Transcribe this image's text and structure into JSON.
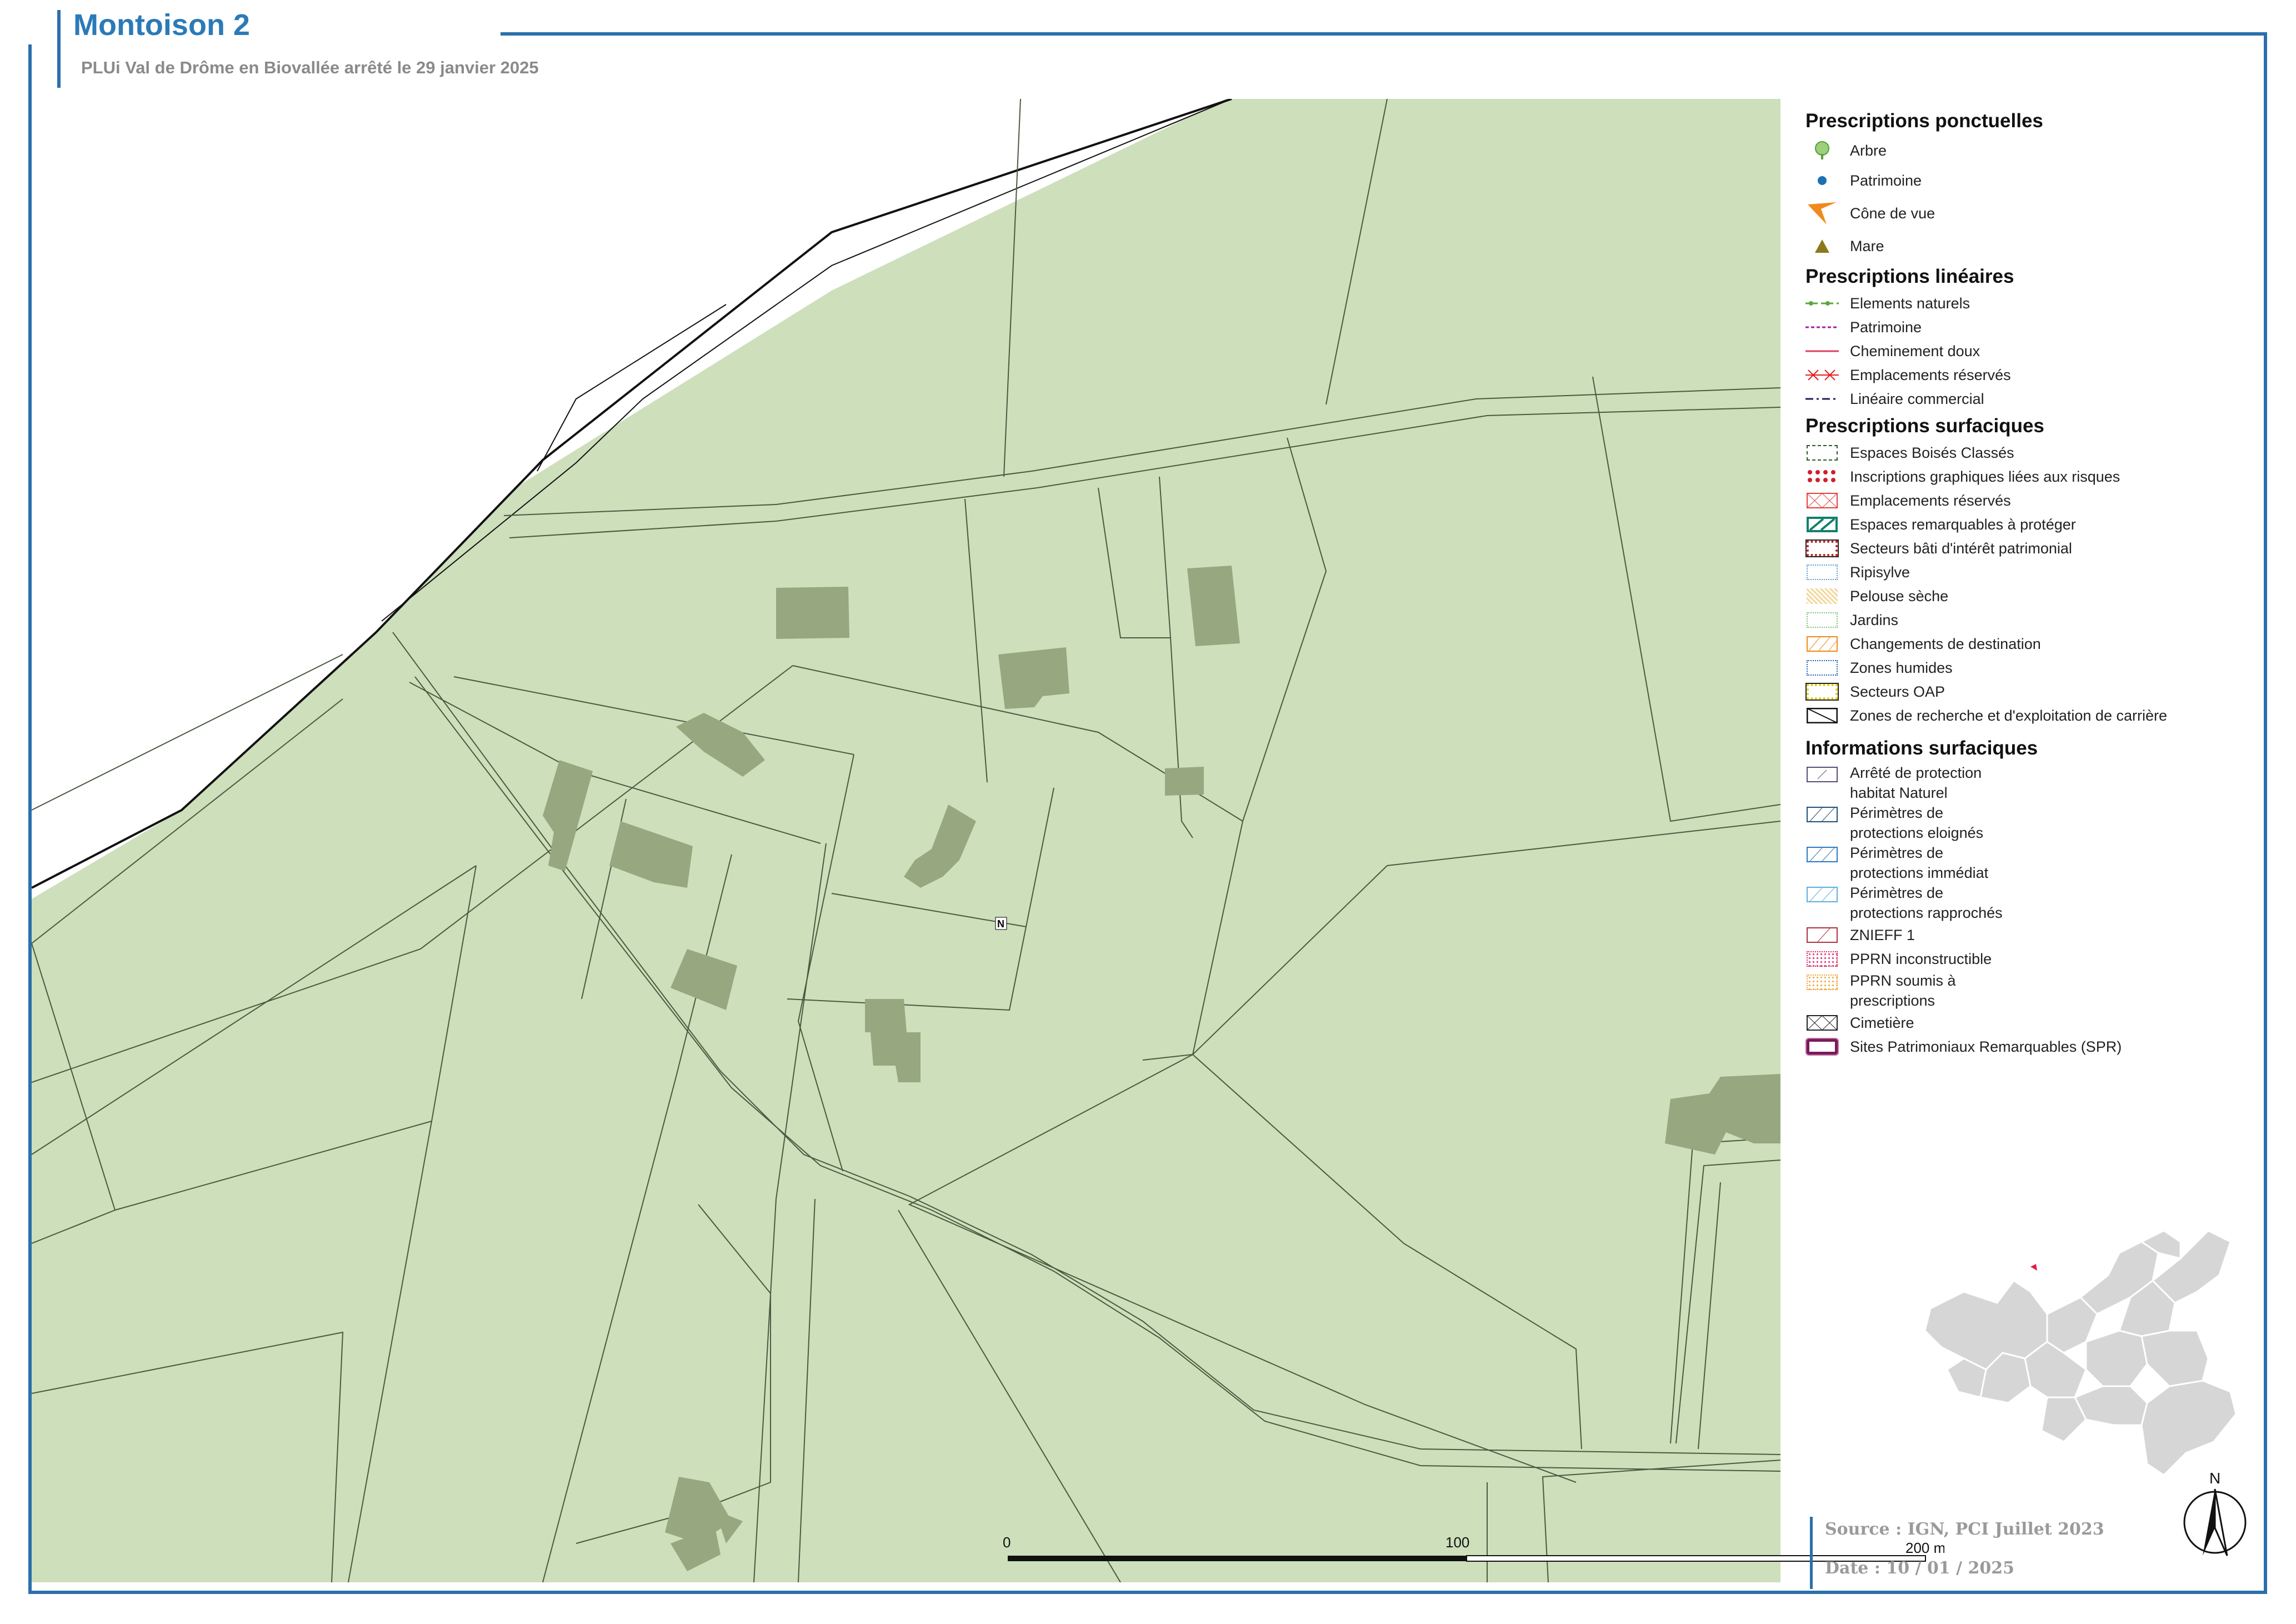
{
  "header": {
    "title": "Montoison 2",
    "subtitle": "PLUi Val de Drôme en Biovallée arrêté le 29 janvier 2025"
  },
  "map": {
    "land_color": "#cddfbb",
    "building_color": "#97a880",
    "parcel_line_color": "#3a4a32",
    "north_label": "N"
  },
  "legend": {
    "ponctuelles": {
      "heading": "Prescriptions ponctuelles",
      "items": [
        {
          "icon": "tree-icon",
          "label": "Arbre"
        },
        {
          "icon": "dot-icon",
          "label": "Patrimoine"
        },
        {
          "icon": "view-cone-icon",
          "label": "Cône de vue"
        },
        {
          "icon": "triangle-icon",
          "label": "Mare"
        }
      ]
    },
    "lineaires": {
      "heading": "Prescriptions linéaires",
      "items": [
        {
          "label": "Elements naturels"
        },
        {
          "label": "Patrimoine"
        },
        {
          "label": "Cheminement doux"
        },
        {
          "label": "Emplacements réservés"
        },
        {
          "label": "Linéaire commercial"
        }
      ]
    },
    "surfaciques": {
      "heading": "Prescriptions surfaciques",
      "items": [
        {
          "label": "Espaces Boisés Classés"
        },
        {
          "label": "Inscriptions graphiques liées aux risques"
        },
        {
          "label": "Emplacements réservés"
        },
        {
          "label": "Espaces remarquables à protéger"
        },
        {
          "label": "Secteurs bâti d'intérêt patrimonial"
        },
        {
          "label": "Ripisylve"
        },
        {
          "label": "Pelouse sèche"
        },
        {
          "label": "Jardins"
        },
        {
          "label": "Changements de destination"
        },
        {
          "label": "Zones humides"
        },
        {
          "label": "Secteurs OAP"
        },
        {
          "label": "Zones de recherche et d'exploitation de carrière"
        }
      ]
    },
    "informations": {
      "heading": "Informations surfaciques",
      "items": [
        {
          "line1": "Arrêté de protection",
          "line2": "habitat Naturel"
        },
        {
          "line1": "Périmètres de",
          "line2": "protections eloignés"
        },
        {
          "line1": "Périmètres de",
          "line2": "protections immédiat"
        },
        {
          "line1": "Périmètres de",
          "line2": "protections rapprochés"
        },
        {
          "line1": "ZNIEFF 1",
          "line2": ""
        },
        {
          "line1": "PPRN inconstructible",
          "line2": ""
        },
        {
          "line1": "PPRN soumis à",
          "line2": "prescriptions"
        },
        {
          "line1": "Cimetière",
          "line2": ""
        },
        {
          "line1": "Sites Patrimoniaux Remarquables (SPR)",
          "line2": ""
        }
      ]
    }
  },
  "scale_bar": {
    "label_0": "0",
    "label_100": "100",
    "label_200": "200 m"
  },
  "footer": {
    "source": "Source : IGN, PCI Juillet 2023",
    "date": "Date : 10 / 01 / 2025"
  },
  "north_arrow": {
    "label": "N"
  }
}
